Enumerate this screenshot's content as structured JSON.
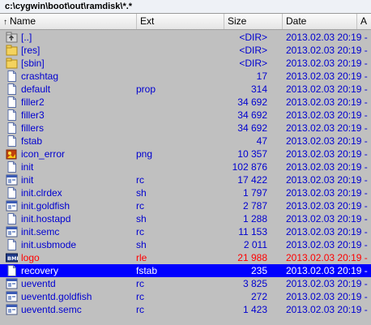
{
  "path": "c:\\cygwin\\boot\\out\\ramdisk\\*.*",
  "columns": {
    "name": "Name",
    "ext": "Ext",
    "size": "Size",
    "date": "Date",
    "attr": "A"
  },
  "colors": {
    "normal": "#0000d0",
    "red": "#ff0000",
    "selected_bg": "#0000ff",
    "selected_text": "#ffffff",
    "bg": "#c0c0c0"
  },
  "files": [
    {
      "name": "[..]",
      "ext": "",
      "size": "<DIR>",
      "date": "2013.02.03 20:19 -",
      "icon": "up-folder-icon",
      "color": "normal"
    },
    {
      "name": "[res]",
      "ext": "",
      "size": "<DIR>",
      "date": "2013.02.03 20:19 -",
      "icon": "folder-icon",
      "color": "normal"
    },
    {
      "name": "[sbin]",
      "ext": "",
      "size": "<DIR>",
      "date": "2013.02.03 20:19 -",
      "icon": "folder-icon",
      "color": "normal"
    },
    {
      "name": "crashtag",
      "ext": "",
      "size": "17",
      "date": "2013.02.03 20:19 -",
      "icon": "file-icon",
      "color": "normal"
    },
    {
      "name": "default",
      "ext": "prop",
      "size": "314",
      "date": "2013.02.03 20:19 -",
      "icon": "file-icon",
      "color": "normal"
    },
    {
      "name": "filler2",
      "ext": "",
      "size": "34 692",
      "date": "2013.02.03 20:19 -",
      "icon": "file-icon",
      "color": "normal"
    },
    {
      "name": "filler3",
      "ext": "",
      "size": "34 692",
      "date": "2013.02.03 20:19 -",
      "icon": "file-icon",
      "color": "normal"
    },
    {
      "name": "fillers",
      "ext": "",
      "size": "34 692",
      "date": "2013.02.03 20:19 -",
      "icon": "file-icon",
      "color": "normal"
    },
    {
      "name": "fstab",
      "ext": "",
      "size": "47",
      "date": "2013.02.03 20:19 -",
      "icon": "file-icon",
      "color": "normal"
    },
    {
      "name": "icon_error",
      "ext": "png",
      "size": "10 357",
      "date": "2013.02.03 20:19 -",
      "icon": "image-icon",
      "color": "normal"
    },
    {
      "name": "init",
      "ext": "",
      "size": "102 876",
      "date": "2013.02.03 20:19 -",
      "icon": "file-icon",
      "color": "normal"
    },
    {
      "name": "init",
      "ext": "rc",
      "size": "17 422",
      "date": "2013.02.03 20:19 -",
      "icon": "config-icon",
      "color": "normal"
    },
    {
      "name": "init.clrdex",
      "ext": "sh",
      "size": "1 797",
      "date": "2013.02.03 20:19 -",
      "icon": "file-icon",
      "color": "normal"
    },
    {
      "name": "init.goldfish",
      "ext": "rc",
      "size": "2 787",
      "date": "2013.02.03 20:19 -",
      "icon": "config-icon",
      "color": "normal"
    },
    {
      "name": "init.hostapd",
      "ext": "sh",
      "size": "1 288",
      "date": "2013.02.03 20:19 -",
      "icon": "file-icon",
      "color": "normal"
    },
    {
      "name": "init.semc",
      "ext": "rc",
      "size": "11 153",
      "date": "2013.02.03 20:19 -",
      "icon": "config-icon",
      "color": "normal"
    },
    {
      "name": "init.usbmode",
      "ext": "sh",
      "size": "2 011",
      "date": "2013.02.03 20:19 -",
      "icon": "file-icon",
      "color": "normal"
    },
    {
      "name": "logo",
      "ext": "rle",
      "size": "21 988",
      "date": "2013.02.03 20:19 -",
      "icon": "bmp-icon",
      "color": "red"
    },
    {
      "name": "recovery",
      "ext": "fstab",
      "size": "235",
      "date": "2013.02.03 20:19 -",
      "icon": "file-icon",
      "color": "selected"
    },
    {
      "name": "ueventd",
      "ext": "rc",
      "size": "3 825",
      "date": "2013.02.03 20:19 -",
      "icon": "config-icon",
      "color": "normal"
    },
    {
      "name": "ueventd.goldfish",
      "ext": "rc",
      "size": "272",
      "date": "2013.02.03 20:19 -",
      "icon": "config-icon",
      "color": "normal"
    },
    {
      "name": "ueventd.semc",
      "ext": "rc",
      "size": "1 423",
      "date": "2013.02.03 20:19 -",
      "icon": "config-icon",
      "color": "normal"
    }
  ]
}
